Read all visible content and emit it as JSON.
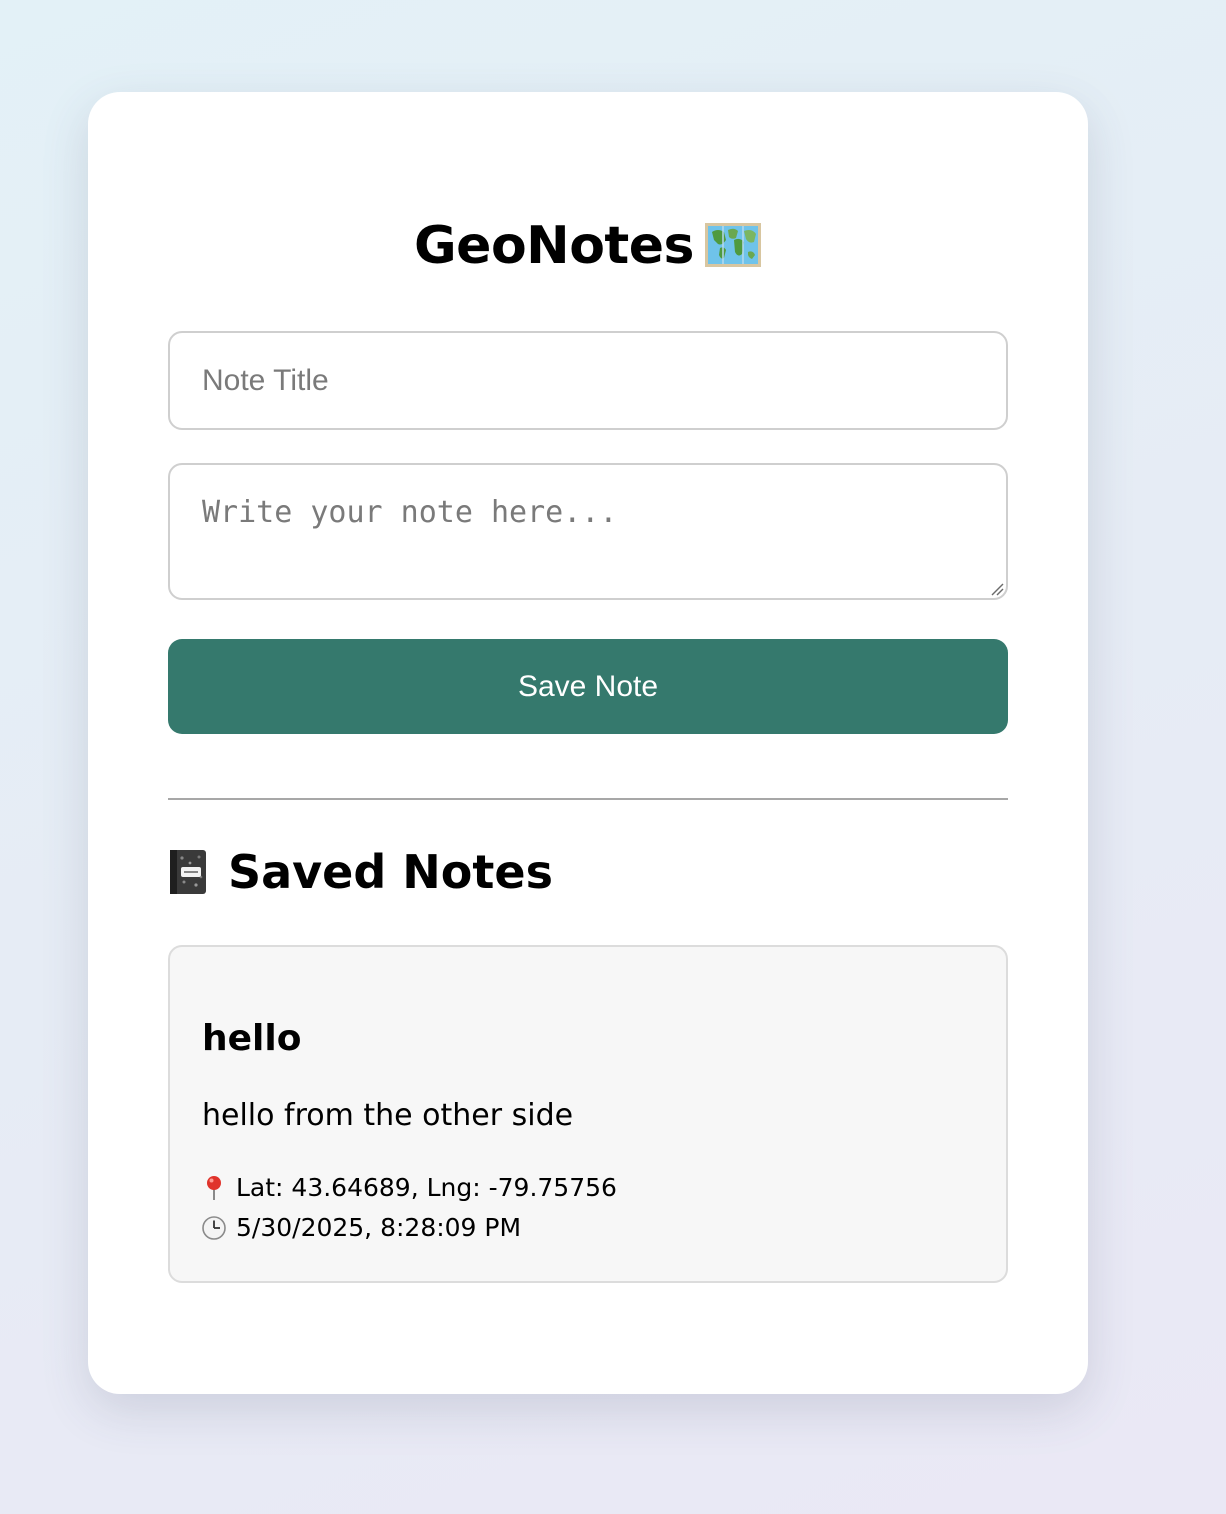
{
  "app": {
    "title": "GeoNotes",
    "title_icon": "world-map-icon"
  },
  "form": {
    "title_placeholder": "Note Title",
    "title_value": "",
    "body_placeholder": "Write your note here...",
    "body_value": "",
    "save_label": "Save Note"
  },
  "saved": {
    "heading": "Saved Notes",
    "heading_icon": "notebook-icon",
    "notes": [
      {
        "title": "hello",
        "body": "hello from the other side",
        "location": "Lat: 43.64689, Lng: -79.75756",
        "location_icon": "pin-icon",
        "timestamp": "5/30/2025, 8:28:09 PM",
        "timestamp_icon": "clock-icon"
      }
    ]
  },
  "colors": {
    "accent": "#35796d",
    "card_background": "#ffffff",
    "note_background": "#f7f7f7"
  }
}
